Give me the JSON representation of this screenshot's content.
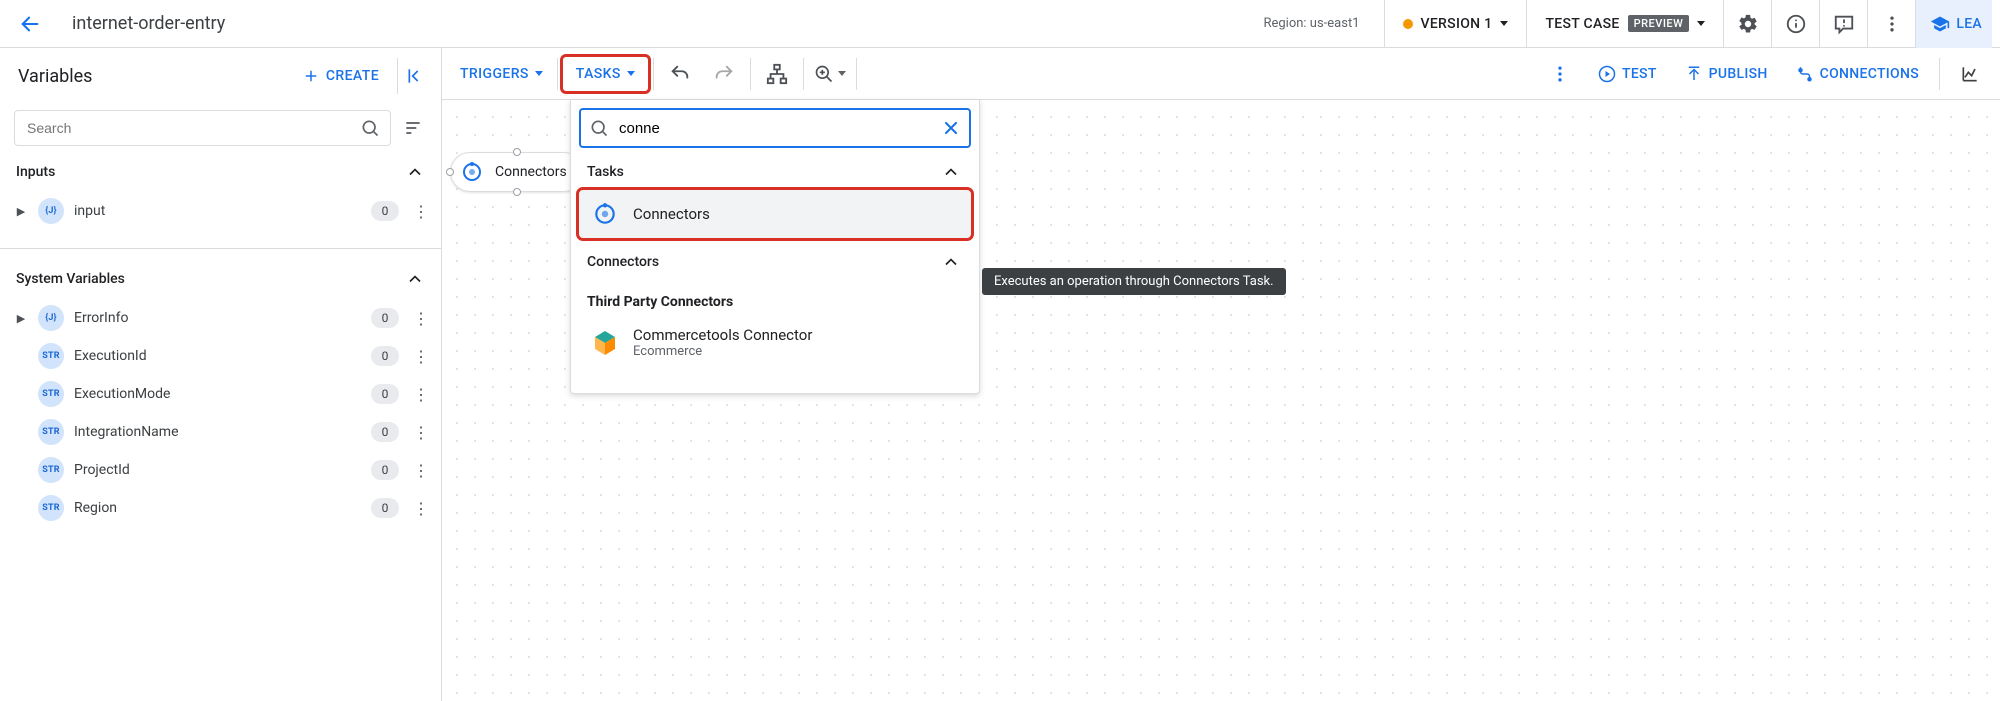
{
  "appbar": {
    "title": "internet-order-entry",
    "region_label": "Region: us-east1",
    "version_label": "VERSION 1",
    "testcase_label": "TEST CASE",
    "testcase_badge": "PREVIEW",
    "learn_label": "LEA"
  },
  "leftpane": {
    "heading": "Variables",
    "create_label": "CREATE",
    "search_placeholder": "Search",
    "inputs_heading": "Inputs",
    "inputs": [
      {
        "type": "{J}",
        "name": "input",
        "count": "0"
      }
    ],
    "sysvars_heading": "System Variables",
    "sysvars": [
      {
        "type": "{J}",
        "name": "ErrorInfo",
        "count": "0",
        "expandable": true
      },
      {
        "type": "STR",
        "name": "ExecutionId",
        "count": "0"
      },
      {
        "type": "STR",
        "name": "ExecutionMode",
        "count": "0"
      },
      {
        "type": "STR",
        "name": "IntegrationName",
        "count": "0"
      },
      {
        "type": "STR",
        "name": "ProjectId",
        "count": "0"
      },
      {
        "type": "STR",
        "name": "Region",
        "count": "0"
      }
    ]
  },
  "toolbar": {
    "triggers": "TRIGGERS",
    "tasks": "TASKS",
    "test": "TEST",
    "publish": "PUBLISH",
    "connections": "CONNECTIONS"
  },
  "node": {
    "label": "Connectors"
  },
  "taskpanel": {
    "search_value": "conne",
    "group_tasks": "Tasks",
    "item_connectors": "Connectors",
    "group_connectors": "Connectors",
    "subheading": "Third Party Connectors",
    "ct_title": "Commercetools Connector",
    "ct_sub": "Ecommerce"
  },
  "tooltip": "Executes an operation through Connectors Task."
}
